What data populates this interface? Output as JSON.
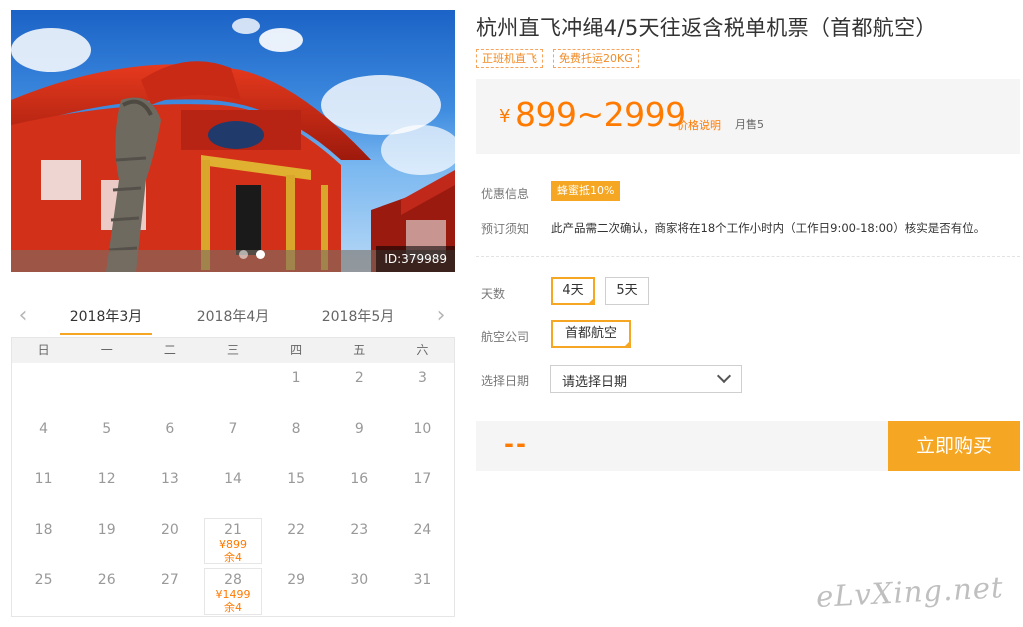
{
  "hero": {
    "id_label": "ID:379989",
    "dots": 2,
    "active_dot": 2
  },
  "product": {
    "title": "杭州直飞冲绳4/5天往返含税单机票（首都航空）",
    "tags": [
      "正班机直飞",
      "免费托运20KG"
    ]
  },
  "price": {
    "currency": "¥",
    "range": "899~2999",
    "note": "价格说明",
    "sales": "月售5"
  },
  "info": {
    "promo_label": "优惠信息",
    "promo_badge": "蜂蜜抵10%",
    "notice_label": "预订须知",
    "notice_text": "此产品需二次确认，商家将在18个工作小时内（工作日9:00-18:00）核实是否有位。"
  },
  "options": {
    "days_label": "天数",
    "days": [
      "4天",
      "5天"
    ],
    "days_selected": "4天",
    "airline_label": "航空公司",
    "airline": "首都航空",
    "date_label": "选择日期",
    "date_placeholder": "请选择日期"
  },
  "buy": {
    "price_display": "--",
    "button": "立即购买"
  },
  "calendar": {
    "months": [
      "2018年3月",
      "2018年4月",
      "2018年5月"
    ],
    "active_month": "2018年3月",
    "weekdays": [
      "日",
      "一",
      "二",
      "三",
      "四",
      "五",
      "六"
    ],
    "weeks": [
      [
        "",
        "",
        "",
        "",
        "1",
        "2",
        "3"
      ],
      [
        "4",
        "5",
        "6",
        "7",
        "8",
        "9",
        "10"
      ],
      [
        "11",
        "12",
        "13",
        "14",
        "15",
        "16",
        "17"
      ],
      [
        "18",
        "19",
        "20",
        "21",
        "22",
        "23",
        "24"
      ],
      [
        "25",
        "26",
        "27",
        "28",
        "29",
        "30",
        "31"
      ]
    ],
    "available": {
      "21": {
        "price": "¥899",
        "stock": "余4"
      },
      "28": {
        "price": "¥1499",
        "stock": "余4"
      }
    }
  },
  "watermark": "eLvXing.net",
  "colors": {
    "accent": "#f5a623",
    "price": "#ff7a00",
    "panel_bg": "#f5f5f5"
  }
}
